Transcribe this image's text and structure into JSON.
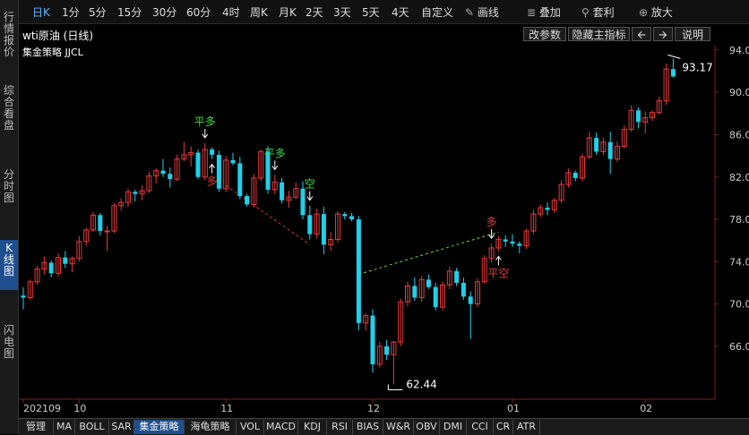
{
  "sidebar": {
    "tabs": [
      {
        "label": "行情报价",
        "active": false
      },
      {
        "label": "综合看盘",
        "active": false
      },
      {
        "label": "分时图",
        "active": false
      },
      {
        "label": "K线图",
        "active": true
      },
      {
        "label": "闪电图",
        "active": false
      }
    ]
  },
  "toolbar": {
    "periods": [
      "日K",
      "1分",
      "5分",
      "15分",
      "30分",
      "60分",
      "4时",
      "周K",
      "月K",
      "2天",
      "3天",
      "5天",
      "4天",
      "自定义"
    ],
    "active_period": "日K",
    "draw_label": "画线",
    "overlay_label": "叠加",
    "template_label": "套利",
    "zoom_label": "放大"
  },
  "info": {
    "title": "wti原油 (日线)",
    "modify_params": "改参数",
    "hide_indicator": "隐藏主指标",
    "help": "说明",
    "strategy_label": "集金策略 JJCL"
  },
  "indicator_tabs": [
    "管理",
    "MA",
    "BOLL",
    "SAR",
    "集金策略",
    "海龟策略",
    "VOL",
    "MACD",
    "KDJ",
    "RSI",
    "BIAS",
    "W&R",
    "OBV",
    "DMI",
    "CCI",
    "CR",
    "ATR"
  ],
  "active_indicator": "集金策略",
  "colors": {
    "up": "#e8393b",
    "down": "#1ed1ea",
    "buy_signal": "#3ddc3d",
    "sell_signal": "#e8393b",
    "trend_up": "#7bd83d",
    "trend_down": "#d0393b"
  },
  "chart_data": {
    "type": "candlestick",
    "y_ticks": [
      94.0,
      90.0,
      86.0,
      82.0,
      78.0,
      74.0,
      70.0,
      66.0
    ],
    "ylim": [
      61.0,
      94.5
    ],
    "x_labels": [
      "202109",
      "10",
      "11",
      "12",
      "01",
      "02"
    ],
    "max_label": "93.17",
    "min_label": "62.44",
    "candles": [
      [
        70.8,
        71.6,
        69.5,
        70.6
      ],
      [
        70.6,
        72.3,
        70.4,
        72.1
      ],
      [
        72.1,
        73.6,
        71.8,
        73.3
      ],
      [
        73.3,
        74.5,
        72.8,
        73.9
      ],
      [
        73.9,
        74.1,
        72.5,
        72.9
      ],
      [
        72.9,
        74.8,
        72.6,
        74.4
      ],
      [
        74.4,
        75.0,
        73.4,
        73.8
      ],
      [
        73.8,
        74.5,
        73.0,
        74.3
      ],
      [
        74.3,
        76.4,
        74.0,
        75.9
      ],
      [
        75.9,
        77.2,
        75.5,
        77.0
      ],
      [
        77.0,
        78.7,
        76.8,
        78.4
      ],
      [
        78.4,
        78.6,
        76.5,
        76.9
      ],
      [
        76.9,
        77.4,
        75.0,
        76.9
      ],
      [
        76.9,
        79.5,
        76.7,
        79.3
      ],
      [
        79.3,
        80.0,
        78.8,
        79.6
      ],
      [
        79.6,
        80.9,
        79.2,
        80.6
      ],
      [
        80.6,
        80.8,
        79.7,
        80.4
      ],
      [
        80.4,
        81.2,
        79.8,
        80.7
      ],
      [
        80.7,
        82.5,
        80.5,
        82.1
      ],
      [
        82.1,
        82.8,
        81.4,
        82.6
      ],
      [
        82.6,
        83.7,
        82.0,
        82.3
      ],
      [
        82.3,
        82.9,
        81.0,
        81.8
      ],
      [
        81.8,
        84.1,
        81.6,
        83.7
      ],
      [
        83.7,
        85.3,
        83.5,
        84.1
      ],
      [
        84.1,
        84.9,
        83.0,
        84.3
      ],
      [
        84.3,
        84.6,
        81.8,
        82.0
      ],
      [
        82.0,
        85.2,
        81.7,
        84.6
      ],
      [
        84.6,
        84.8,
        83.7,
        84.1
      ],
      [
        84.1,
        84.5,
        80.6,
        80.9
      ],
      [
        80.9,
        84.0,
        80.6,
        83.6
      ],
      [
        83.6,
        84.3,
        83.1,
        83.3
      ],
      [
        83.3,
        83.9,
        79.9,
        80.2
      ],
      [
        80.2,
        80.4,
        79.2,
        79.4
      ],
      [
        79.4,
        82.3,
        79.1,
        81.9
      ],
      [
        81.9,
        84.6,
        81.6,
        84.4
      ],
      [
        84.4,
        84.9,
        80.4,
        80.8
      ],
      [
        80.8,
        82.2,
        80.4,
        81.5
      ],
      [
        81.5,
        81.9,
        79.5,
        79.8
      ],
      [
        79.8,
        80.7,
        79.1,
        80.1
      ],
      [
        80.1,
        81.5,
        79.9,
        80.9
      ],
      [
        80.9,
        81.6,
        78.0,
        78.4
      ],
      [
        78.4,
        79.3,
        76.1,
        76.6
      ],
      [
        76.6,
        79.0,
        76.2,
        78.5
      ],
      [
        78.5,
        79.2,
        74.7,
        75.6
      ],
      [
        75.6,
        76.8,
        75.0,
        76.1
      ],
      [
        76.1,
        78.8,
        75.8,
        78.5
      ],
      [
        78.5,
        78.7,
        78.0,
        78.3
      ],
      [
        78.3,
        78.6,
        77.8,
        78.0
      ],
      [
        78.0,
        78.3,
        67.5,
        68.2
      ],
      [
        68.2,
        69.1,
        67.5,
        68.9
      ],
      [
        68.9,
        69.5,
        63.5,
        64.3
      ],
      [
        64.3,
        66.4,
        64.0,
        66.0
      ],
      [
        66.0,
        66.6,
        64.7,
        65.2
      ],
      [
        65.2,
        66.5,
        62.4,
        66.4
      ],
      [
        66.4,
        70.5,
        66.0,
        70.2
      ],
      [
        70.2,
        72.1,
        69.8,
        71.7
      ],
      [
        71.7,
        72.5,
        70.3,
        70.6
      ],
      [
        70.6,
        72.6,
        70.2,
        72.3
      ],
      [
        72.3,
        72.8,
        71.4,
        71.6
      ],
      [
        71.6,
        72.0,
        69.4,
        69.7
      ],
      [
        69.7,
        72.1,
        69.4,
        71.8
      ],
      [
        71.8,
        73.5,
        71.4,
        73.1
      ],
      [
        73.1,
        73.4,
        71.7,
        72.0
      ],
      [
        72.0,
        72.5,
        70.4,
        70.7
      ],
      [
        70.7,
        71.2,
        66.7,
        70.0
      ],
      [
        70.0,
        72.4,
        69.7,
        72.1
      ],
      [
        72.1,
        74.6,
        71.9,
        74.3
      ],
      [
        74.3,
        75.7,
        73.9,
        75.3
      ],
      [
        75.3,
        76.4,
        75.0,
        76.1
      ],
      [
        76.1,
        76.5,
        75.4,
        75.9
      ],
      [
        75.9,
        76.6,
        75.4,
        75.7
      ],
      [
        75.7,
        75.9,
        74.8,
        75.5
      ],
      [
        75.5,
        77.1,
        75.2,
        76.9
      ],
      [
        76.9,
        78.9,
        76.6,
        78.5
      ],
      [
        78.5,
        79.4,
        78.2,
        79.1
      ],
      [
        79.1,
        79.6,
        78.4,
        78.9
      ],
      [
        78.9,
        80.0,
        78.6,
        79.8
      ],
      [
        79.8,
        81.7,
        79.5,
        81.3
      ],
      [
        81.3,
        82.8,
        81.0,
        82.4
      ],
      [
        82.4,
        82.6,
        81.6,
        81.9
      ],
      [
        81.9,
        84.2,
        81.6,
        83.9
      ],
      [
        83.9,
        86.3,
        83.7,
        85.7
      ],
      [
        85.7,
        86.2,
        84.1,
        84.4
      ],
      [
        84.4,
        85.7,
        84.1,
        85.3
      ],
      [
        85.3,
        86.3,
        82.3,
        83.7
      ],
      [
        83.7,
        85.4,
        83.4,
        84.9
      ],
      [
        84.9,
        86.9,
        84.7,
        86.5
      ],
      [
        86.5,
        88.8,
        86.3,
        88.3
      ],
      [
        88.3,
        88.6,
        86.6,
        87.2
      ],
      [
        87.2,
        88.2,
        86.1,
        87.6
      ],
      [
        87.6,
        88.3,
        87.3,
        88.1
      ],
      [
        88.1,
        89.6,
        87.9,
        89.2
      ],
      [
        89.2,
        92.7,
        88.8,
        92.2
      ],
      [
        92.2,
        93.2,
        91.4,
        91.5
      ]
    ],
    "signals": [
      {
        "label": "平多",
        "index": 26,
        "kind": "buy"
      },
      {
        "label": "多",
        "index": 27,
        "kind": "sell"
      },
      {
        "label": "平多",
        "index": 36,
        "kind": "buy"
      },
      {
        "label": "空",
        "index": 41,
        "kind": "buy"
      },
      {
        "label": "多",
        "index": 67,
        "kind": "sell"
      },
      {
        "label": "平空",
        "index": 68,
        "kind": "sell"
      }
    ]
  }
}
